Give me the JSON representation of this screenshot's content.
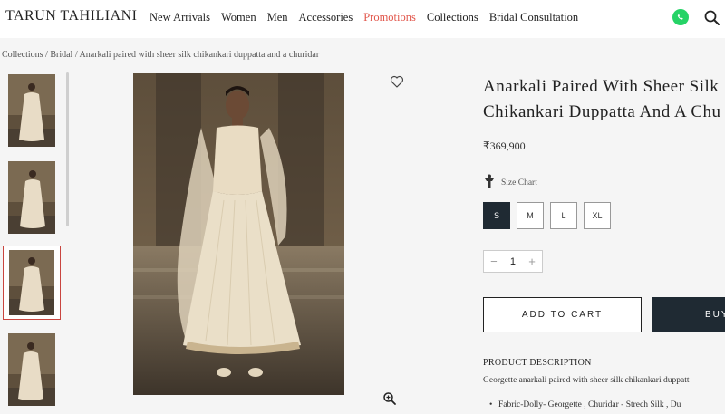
{
  "header": {
    "logo": "TARUN TAHILIANI",
    "nav": [
      {
        "label": "New Arrivals",
        "highlight": false
      },
      {
        "label": "Women",
        "highlight": false
      },
      {
        "label": "Men",
        "highlight": false
      },
      {
        "label": "Accessories",
        "highlight": false
      },
      {
        "label": "Promotions",
        "highlight": true
      },
      {
        "label": "Collections",
        "highlight": false
      },
      {
        "label": "Bridal Consultation",
        "highlight": false
      }
    ],
    "icons": [
      "whatsapp-icon",
      "search-icon"
    ]
  },
  "breadcrumb": "Collections / Bridal / Anarkali paired with sheer silk chikankari duppatta and a churidar",
  "gallery": {
    "thumbnail_count": 4,
    "selected_index": 2
  },
  "product": {
    "title_line1": "Anarkali Paired With Sheer Silk",
    "title_line2": "Chikankari Duppatta And A Chu",
    "price": "₹369,900",
    "size_chart_label": "Size Chart",
    "sizes": [
      "S",
      "M",
      "L",
      "XL"
    ],
    "selected_size": "S",
    "quantity": "1",
    "qty_minus": "−",
    "qty_plus": "+",
    "add_to_cart": "ADD TO CART",
    "buy_now": "BUY",
    "description_heading": "PRODUCT DESCRIPTION",
    "description_text": "Georgette anarkali paired with sheer silk chikankari duppatt",
    "description_bullet": "Fabric-Dolly- Georgette , Churidar - Strech Silk , Du"
  },
  "colors": {
    "accent": "#e2574c",
    "dark_button": "#1f2a33",
    "background": "#f5f5f5"
  }
}
